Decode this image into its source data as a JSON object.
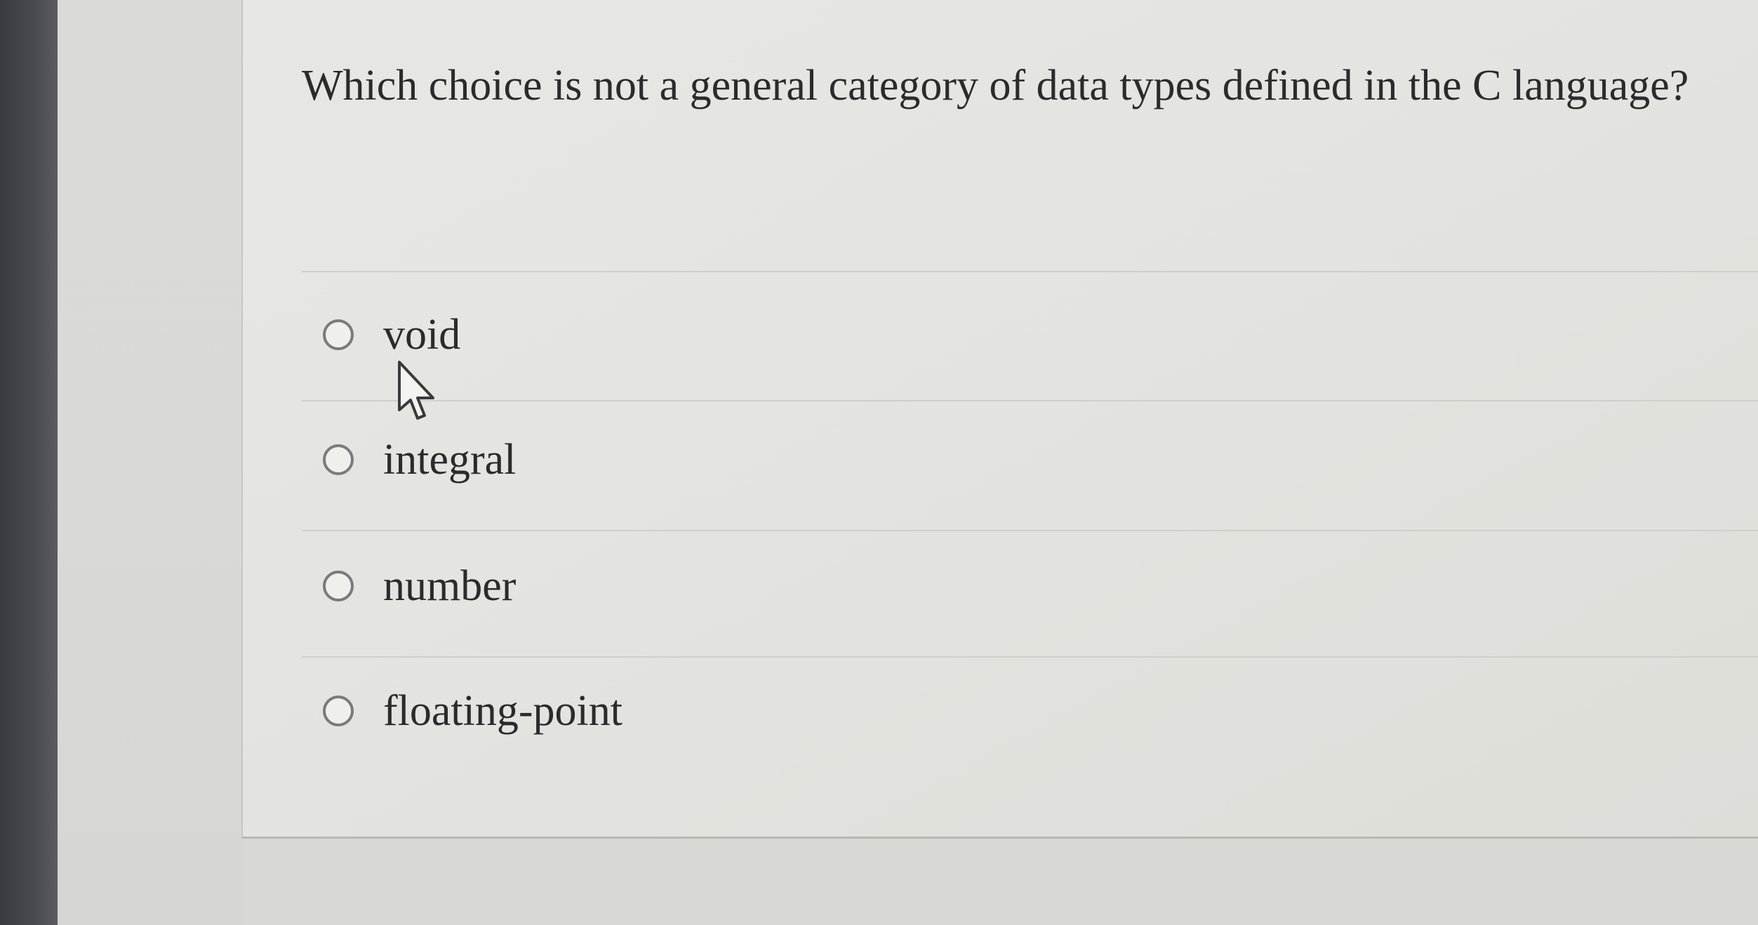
{
  "question": {
    "text": "Which choice is not a general category of data types defined in the C language?"
  },
  "options": [
    {
      "label": "void",
      "selected": false
    },
    {
      "label": "integral",
      "selected": false
    },
    {
      "label": "number",
      "selected": false
    },
    {
      "label": "floating-point",
      "selected": false
    }
  ],
  "icons": {
    "cursor": "mouse-pointer-icon",
    "radio": "radio-unselected-icon"
  }
}
